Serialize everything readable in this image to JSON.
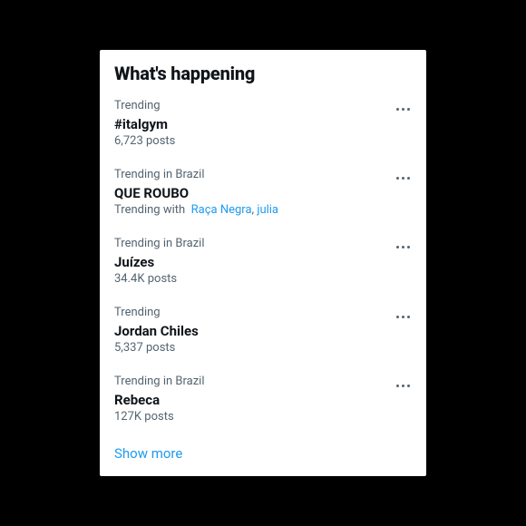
{
  "header": {
    "title": "What's happening"
  },
  "trends": [
    {
      "context": "Trending",
      "topic": "#italgym",
      "count": "6,723 posts",
      "trending_with_prefix": null,
      "trending_with_links": []
    },
    {
      "context": "Trending in Brazil",
      "topic": "QUE ROUBO",
      "count": null,
      "trending_with_prefix": "Trending with",
      "trending_with_links": [
        "Raça Negra",
        "julia"
      ]
    },
    {
      "context": "Trending in Brazil",
      "topic": "Juízes",
      "count": "34.4K posts",
      "trending_with_prefix": null,
      "trending_with_links": []
    },
    {
      "context": "Trending",
      "topic": "Jordan Chiles",
      "count": "5,337 posts",
      "trending_with_prefix": null,
      "trending_with_links": []
    },
    {
      "context": "Trending in Brazil",
      "topic": "Rebeca",
      "count": "127K posts",
      "trending_with_prefix": null,
      "trending_with_links": []
    }
  ],
  "footer": {
    "show_more": "Show more"
  }
}
